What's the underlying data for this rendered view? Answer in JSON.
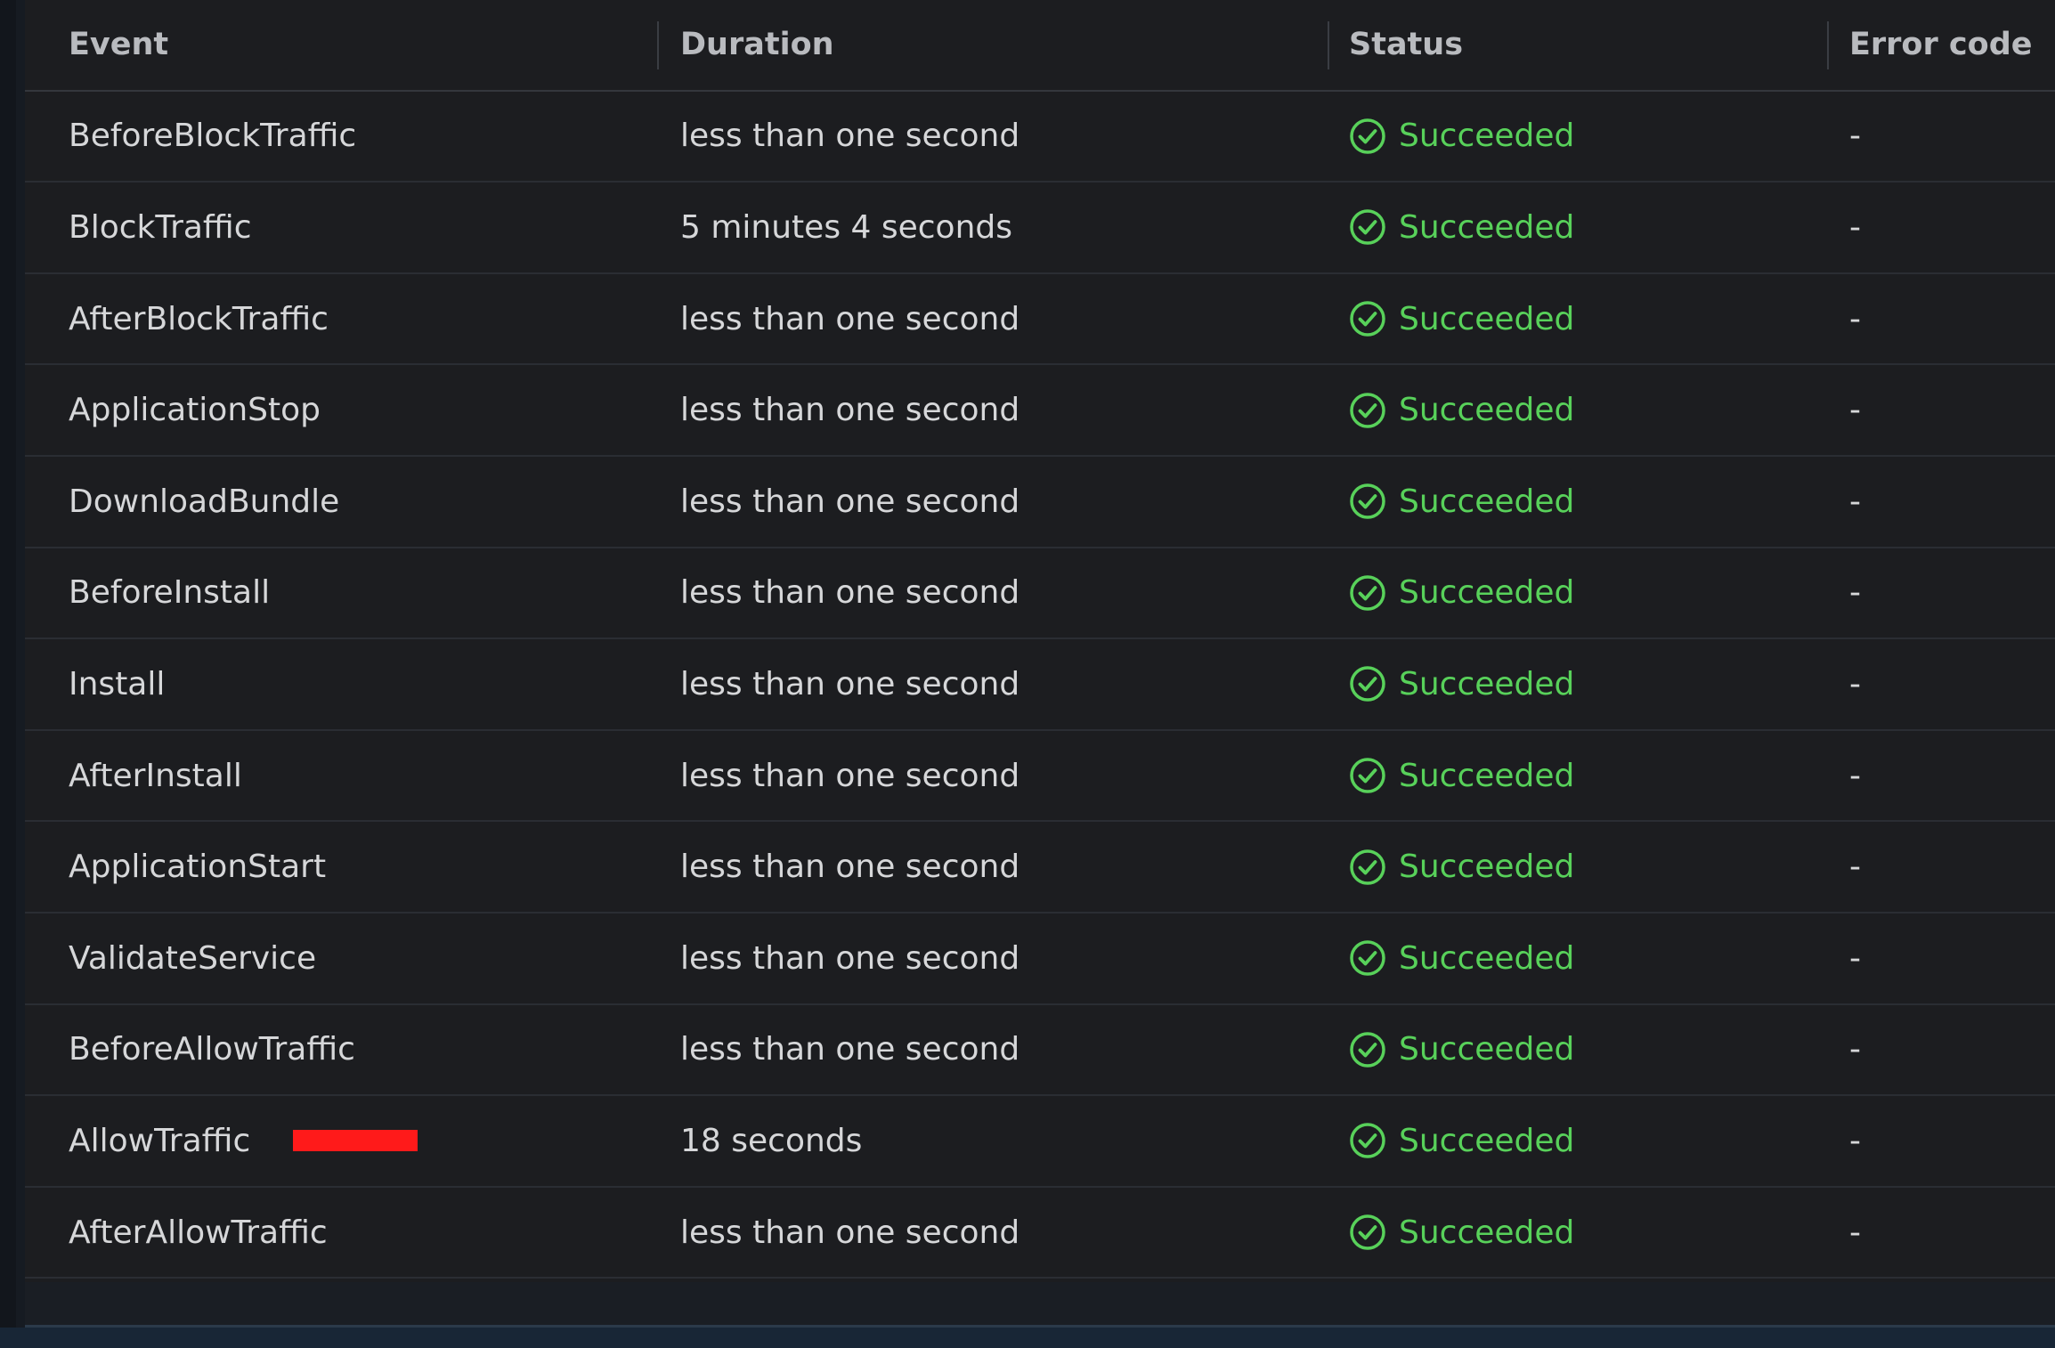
{
  "table": {
    "columns": [
      "Event",
      "Duration",
      "Status",
      "Error code"
    ],
    "rows": [
      {
        "event": "BeforeBlockTraffic",
        "duration": "less than one second",
        "status": "Succeeded",
        "error_code": "-"
      },
      {
        "event": "BlockTraffic",
        "duration": "5 minutes 4 seconds",
        "status": "Succeeded",
        "error_code": "-"
      },
      {
        "event": "AfterBlockTraffic",
        "duration": "less than one second",
        "status": "Succeeded",
        "error_code": "-"
      },
      {
        "event": "ApplicationStop",
        "duration": "less than one second",
        "status": "Succeeded",
        "error_code": "-"
      },
      {
        "event": "DownloadBundle",
        "duration": "less than one second",
        "status": "Succeeded",
        "error_code": "-"
      },
      {
        "event": "BeforeInstall",
        "duration": "less than one second",
        "status": "Succeeded",
        "error_code": "-"
      },
      {
        "event": "Install",
        "duration": "less than one second",
        "status": "Succeeded",
        "error_code": "-"
      },
      {
        "event": "AfterInstall",
        "duration": "less than one second",
        "status": "Succeeded",
        "error_code": "-"
      },
      {
        "event": "ApplicationStart",
        "duration": "less than one second",
        "status": "Succeeded",
        "error_code": "-"
      },
      {
        "event": "ValidateService",
        "duration": "less than one second",
        "status": "Succeeded",
        "error_code": "-"
      },
      {
        "event": "BeforeAllowTraffic",
        "duration": "less than one second",
        "status": "Succeeded",
        "error_code": "-"
      },
      {
        "event": "AllowTraffic",
        "duration": "18 seconds",
        "status": "Succeeded",
        "error_code": "-"
      },
      {
        "event": "AfterAllowTraffic",
        "duration": "less than one second",
        "status": "Succeeded",
        "error_code": "-"
      }
    ]
  },
  "icons": {
    "status_icon": "check-circle-icon"
  },
  "colors": {
    "success": "#58d15a",
    "annotation": "#ff1a1a",
    "background": "#1c1d20"
  }
}
